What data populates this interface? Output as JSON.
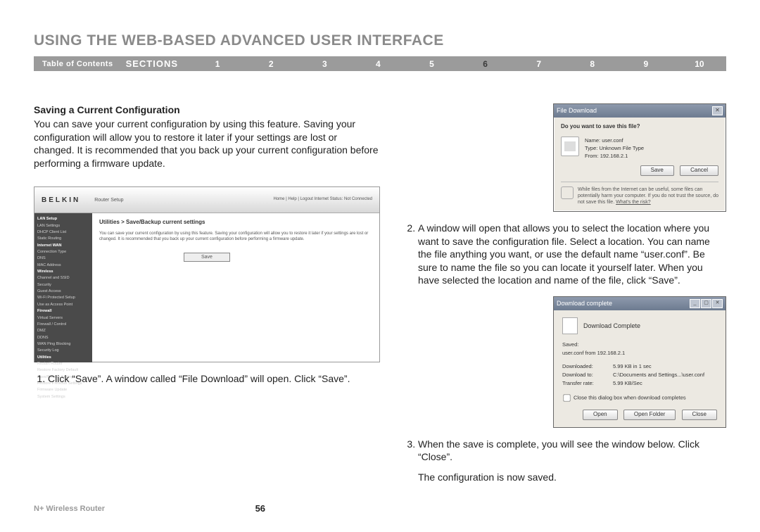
{
  "title": "USING THE WEB-BASED ADVANCED USER INTERFACE",
  "navbar": {
    "toc": "Table of Contents",
    "sections": "SECTIONS",
    "nums": [
      "1",
      "2",
      "3",
      "4",
      "5",
      "6",
      "7",
      "8",
      "9",
      "10"
    ],
    "active": "6"
  },
  "left": {
    "heading": "Saving a Current Configuration",
    "para": "You can save your current configuration by using this feature. Saving your configuration will allow you to restore it later if your settings are lost or changed. It is recommended that you back up your current configuration before performing a firmware update.",
    "step1": "Click “Save”. A window called “File Download” will open. Click “Save”."
  },
  "belkin": {
    "logo": "BELKIN",
    "rs": "Router Setup",
    "links": "Home | Help | Logout    Internet Status: Not Connected",
    "side": {
      "lan": "LAN Setup",
      "lan1": "LAN Settings",
      "lan2": "DHCP Client List",
      "lan3": "Static Routing",
      "wan": "Internet WAN",
      "wan1": "Connection Type",
      "wan2": "DNS",
      "wan3": "MAC Address",
      "wl": "Wireless",
      "wl1": "Channel and SSID",
      "wl2": "Security",
      "wl3": "Guest Access",
      "wl4": "Wi-Fi Protected Setup",
      "wl5": "Use as Access Point",
      "fw": "Firewall",
      "fw1": "Virtual Servers",
      "fw2": "Firewall / Control",
      "fw3": "DMZ",
      "fw4": "DDNS",
      "fw5": "WAN Ping Blocking",
      "fw6": "Security Log",
      "ut": "Utilities",
      "ut1": "Restart Router",
      "ut2": "Restore Factory Default",
      "ut3": "Save/Backup Settings",
      "ut4": "Restore Previous Settings",
      "ut5": "Firmware Update",
      "ut6": "System Settings"
    },
    "bc": "Utilities > Save/Backup current settings",
    "desc": "You can save your current configuration by using this feature. Saving your configuration will allow you to restore it later if your settings are lost or changed. It is recommended that you back up your current configuration before performing a firmware update.",
    "save": "Save"
  },
  "dlg1": {
    "title": "File Download",
    "q": "Do you want to save this file?",
    "name_k": "Name:",
    "name_v": "user.conf",
    "type_k": "Type:",
    "type_v": "Unknown File Type",
    "from_k": "From:",
    "from_v": "192.168.2.1",
    "save": "Save",
    "cancel": "Cancel",
    "warn": "While files from the Internet can be useful, some files can potentially harm your computer. If you do not trust the source, do not save this file.",
    "risk": "What's the risk?"
  },
  "right": {
    "step2": "A window will open that allows you to select the location where you want to save the configuration file. Select a location. You can name the file anything you want, or use the default name “user.conf”. Be sure to name the file so you can locate it yourself later. When you have selected the location and name of the file, click “Save”.",
    "step3": "When the save is complete, you will see the window below. Click “Close”.",
    "final": "The configuration is now saved."
  },
  "dlg2": {
    "title": "Download complete",
    "h": "Download Complete",
    "saved_k": "Saved:",
    "saved_v": "user.conf from 192.168.2.1",
    "d_k": "Downloaded:",
    "d_v": "5.99 KB in 1 sec",
    "dt_k": "Download to:",
    "dt_v": "C:\\Documents and Settings...\\user.conf",
    "tr_k": "Transfer rate:",
    "tr_v": "5.99 KB/Sec",
    "chk": "Close this dialog box when download completes",
    "open": "Open",
    "openf": "Open Folder",
    "close": "Close"
  },
  "footer": {
    "product": "N+ Wireless Router",
    "page": "56"
  }
}
